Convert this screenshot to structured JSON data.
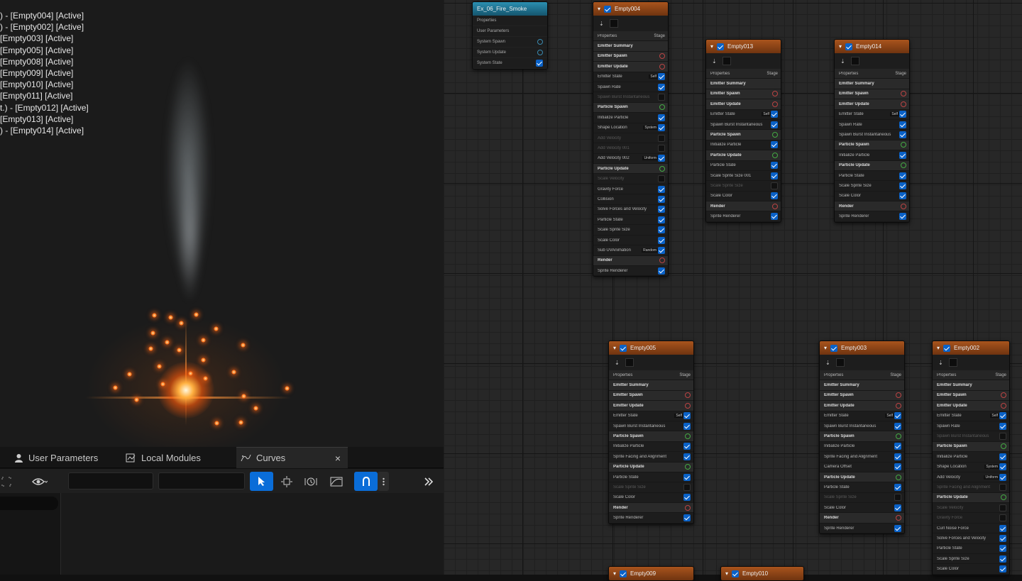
{
  "viewport": {
    "emitter_list": [
      ") - [Empty004] [Active]",
      ") - [Empty002] [Active]",
      "[Empty003] [Active]",
      "[Empty005] [Active]",
      "[Empty008] [Active]",
      "[Empty009] [Active]",
      "[Empty010] [Active]",
      "[Empty011] [Active]",
      "t.) - [Empty012] [Active]",
      "[Empty013] [Active]",
      ") - [Empty014] [Active]"
    ]
  },
  "tabs": {
    "user_parameters": "User Parameters",
    "local_modules": "Local Modules",
    "curves": "Curves",
    "close_glyph": "×"
  },
  "graph": {
    "system_node": {
      "title": "Ex_06_Fire_Smoke",
      "rows": [
        "Properties",
        "User Parameters",
        "System Spawn",
        "System Update",
        "System State"
      ]
    },
    "labels": {
      "properties": "Properties",
      "stage": "Stage",
      "emitter_summary": "Emitter Summary",
      "emitter_spawn": "Emitter Spawn",
      "emitter_update": "Emitter Update",
      "particle_spawn": "Particle Spawn",
      "particle_update": "Particle Update",
      "render": "Render",
      "self": "Self",
      "infinite": "Infinite",
      "system": "System",
      "random": "Random",
      "uniform": "Uniform"
    },
    "node_titles": [
      "Empty004",
      "Empty013",
      "Empty014",
      "Empty005",
      "Empty003",
      "Empty002",
      "Empty009",
      "Empty010"
    ],
    "items": {
      "emitter_state": "Emitter State",
      "spawn_rate": "Spawn Rate",
      "spawn_burst": "Spawn Burst Instantaneous",
      "initialize_particle": "Initialize Particle",
      "shape_location": "Shape Location",
      "add_velocity": "Add Velocity",
      "add_velocity_001": "Add Velocity 001",
      "add_velocity_002": "Add Velocity 002",
      "scale_velocity": "Scale Velocity",
      "gravity_force": "Gravity Force",
      "collision": "Collision",
      "solve_forces": "Solve Forces and Velocity",
      "particle_state": "Particle State",
      "scale_sprite_size": "Scale Sprite Size",
      "scale_sprite_size_001": "Scale Sprite Size 001",
      "scale_color": "Scale Color",
      "sub_uv": "Sub UVAnimation",
      "sprite_renderer": "Sprite Renderer",
      "sprite_facing": "Sprite Facing and Alignment",
      "camera_offset": "Camera Offset",
      "curl_noise": "Curl Noise Force"
    }
  },
  "colors": {
    "accent_blue": "#0a6dd8",
    "emitter_header": "#a9541d",
    "system_header": "#2b8fb1"
  }
}
